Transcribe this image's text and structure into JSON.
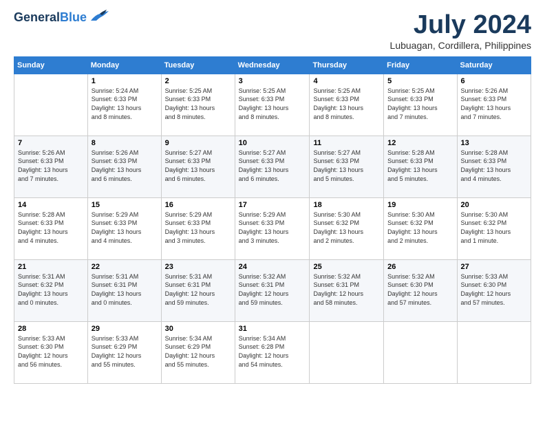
{
  "app": {
    "logo_general": "General",
    "logo_blue": "Blue",
    "main_title": "July 2024",
    "subtitle": "Lubuagan, Cordillera, Philippines"
  },
  "calendar": {
    "headers": [
      "Sunday",
      "Monday",
      "Tuesday",
      "Wednesday",
      "Thursday",
      "Friday",
      "Saturday"
    ],
    "weeks": [
      [
        {
          "day": "",
          "info": ""
        },
        {
          "day": "1",
          "info": "Sunrise: 5:24 AM\nSunset: 6:33 PM\nDaylight: 13 hours\nand 8 minutes."
        },
        {
          "day": "2",
          "info": "Sunrise: 5:25 AM\nSunset: 6:33 PM\nDaylight: 13 hours\nand 8 minutes."
        },
        {
          "day": "3",
          "info": "Sunrise: 5:25 AM\nSunset: 6:33 PM\nDaylight: 13 hours\nand 8 minutes."
        },
        {
          "day": "4",
          "info": "Sunrise: 5:25 AM\nSunset: 6:33 PM\nDaylight: 13 hours\nand 8 minutes."
        },
        {
          "day": "5",
          "info": "Sunrise: 5:25 AM\nSunset: 6:33 PM\nDaylight: 13 hours\nand 7 minutes."
        },
        {
          "day": "6",
          "info": "Sunrise: 5:26 AM\nSunset: 6:33 PM\nDaylight: 13 hours\nand 7 minutes."
        }
      ],
      [
        {
          "day": "7",
          "info": "Sunrise: 5:26 AM\nSunset: 6:33 PM\nDaylight: 13 hours\nand 7 minutes."
        },
        {
          "day": "8",
          "info": "Sunrise: 5:26 AM\nSunset: 6:33 PM\nDaylight: 13 hours\nand 6 minutes."
        },
        {
          "day": "9",
          "info": "Sunrise: 5:27 AM\nSunset: 6:33 PM\nDaylight: 13 hours\nand 6 minutes."
        },
        {
          "day": "10",
          "info": "Sunrise: 5:27 AM\nSunset: 6:33 PM\nDaylight: 13 hours\nand 6 minutes."
        },
        {
          "day": "11",
          "info": "Sunrise: 5:27 AM\nSunset: 6:33 PM\nDaylight: 13 hours\nand 5 minutes."
        },
        {
          "day": "12",
          "info": "Sunrise: 5:28 AM\nSunset: 6:33 PM\nDaylight: 13 hours\nand 5 minutes."
        },
        {
          "day": "13",
          "info": "Sunrise: 5:28 AM\nSunset: 6:33 PM\nDaylight: 13 hours\nand 4 minutes."
        }
      ],
      [
        {
          "day": "14",
          "info": "Sunrise: 5:28 AM\nSunset: 6:33 PM\nDaylight: 13 hours\nand 4 minutes."
        },
        {
          "day": "15",
          "info": "Sunrise: 5:29 AM\nSunset: 6:33 PM\nDaylight: 13 hours\nand 4 minutes."
        },
        {
          "day": "16",
          "info": "Sunrise: 5:29 AM\nSunset: 6:33 PM\nDaylight: 13 hours\nand 3 minutes."
        },
        {
          "day": "17",
          "info": "Sunrise: 5:29 AM\nSunset: 6:33 PM\nDaylight: 13 hours\nand 3 minutes."
        },
        {
          "day": "18",
          "info": "Sunrise: 5:30 AM\nSunset: 6:32 PM\nDaylight: 13 hours\nand 2 minutes."
        },
        {
          "day": "19",
          "info": "Sunrise: 5:30 AM\nSunset: 6:32 PM\nDaylight: 13 hours\nand 2 minutes."
        },
        {
          "day": "20",
          "info": "Sunrise: 5:30 AM\nSunset: 6:32 PM\nDaylight: 13 hours\nand 1 minute."
        }
      ],
      [
        {
          "day": "21",
          "info": "Sunrise: 5:31 AM\nSunset: 6:32 PM\nDaylight: 13 hours\nand 0 minutes."
        },
        {
          "day": "22",
          "info": "Sunrise: 5:31 AM\nSunset: 6:31 PM\nDaylight: 13 hours\nand 0 minutes."
        },
        {
          "day": "23",
          "info": "Sunrise: 5:31 AM\nSunset: 6:31 PM\nDaylight: 12 hours\nand 59 minutes."
        },
        {
          "day": "24",
          "info": "Sunrise: 5:32 AM\nSunset: 6:31 PM\nDaylight: 12 hours\nand 59 minutes."
        },
        {
          "day": "25",
          "info": "Sunrise: 5:32 AM\nSunset: 6:31 PM\nDaylight: 12 hours\nand 58 minutes."
        },
        {
          "day": "26",
          "info": "Sunrise: 5:32 AM\nSunset: 6:30 PM\nDaylight: 12 hours\nand 57 minutes."
        },
        {
          "day": "27",
          "info": "Sunrise: 5:33 AM\nSunset: 6:30 PM\nDaylight: 12 hours\nand 57 minutes."
        }
      ],
      [
        {
          "day": "28",
          "info": "Sunrise: 5:33 AM\nSunset: 6:30 PM\nDaylight: 12 hours\nand 56 minutes."
        },
        {
          "day": "29",
          "info": "Sunrise: 5:33 AM\nSunset: 6:29 PM\nDaylight: 12 hours\nand 55 minutes."
        },
        {
          "day": "30",
          "info": "Sunrise: 5:34 AM\nSunset: 6:29 PM\nDaylight: 12 hours\nand 55 minutes."
        },
        {
          "day": "31",
          "info": "Sunrise: 5:34 AM\nSunset: 6:28 PM\nDaylight: 12 hours\nand 54 minutes."
        },
        {
          "day": "",
          "info": ""
        },
        {
          "day": "",
          "info": ""
        },
        {
          "day": "",
          "info": ""
        }
      ]
    ]
  }
}
